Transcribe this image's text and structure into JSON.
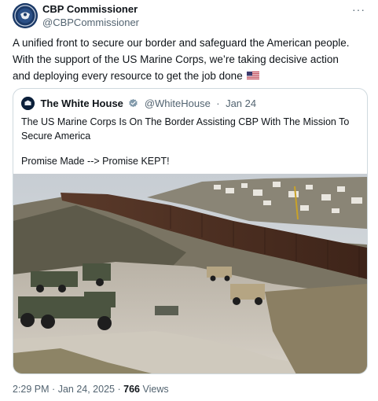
{
  "tweet": {
    "author": {
      "display_name": "CBP Commissioner",
      "handle": "@CBPCommissioner",
      "avatar_icon": "cbp-seal-icon"
    },
    "more_icon": "more-dots-icon",
    "more_label": "···",
    "text_line_1": "A unified front to secure our border and safeguard the American people.",
    "text_line_2": "With the support of the US Marine Corps, we’re taking decisive action",
    "text_line_3": "and deploying every resource to get the job done",
    "flag_icon": "us-flag-icon",
    "quoted": {
      "display_name": "The White House",
      "verified_icon": "verified-badge-icon",
      "handle": "@WhiteHouse",
      "separator": "·",
      "date": "Jan 24",
      "text_line_1": "The US Marine Corps Is On The Border Assisting CBP With The Mission To",
      "text_line_2": "Secure America",
      "text_line_3": "Promise Made --> Promise KEPT!",
      "media_icon": "border-wall-photo"
    },
    "footer": {
      "time": "2:29 PM",
      "separator": "·",
      "date": "Jan 24, 2025",
      "views_count": "766",
      "views_label": "Views"
    },
    "colors": {
      "text": "#0f1419",
      "secondary": "#536471",
      "border": "#cfd9de",
      "verified": "#829aab"
    }
  }
}
